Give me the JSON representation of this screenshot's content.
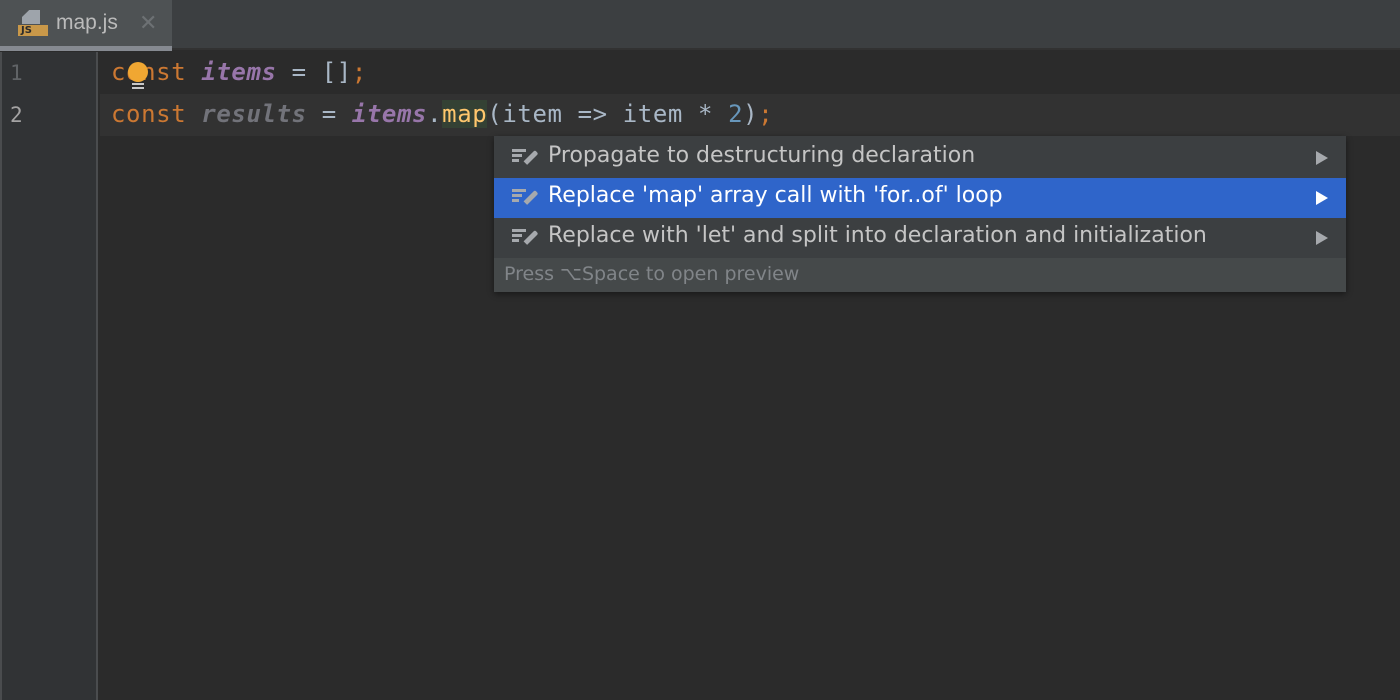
{
  "tabs": [
    {
      "label": "map.js",
      "file_type": "JS",
      "icon": "javascript-file-icon",
      "active": true
    }
  ],
  "editor": {
    "line_numbers": [
      "1",
      "2"
    ],
    "current_line": 2,
    "lines": [
      {
        "tokens": [
          {
            "text": "const",
            "type": "keyword"
          },
          {
            "text": " ",
            "type": "plain"
          },
          {
            "text": "items",
            "type": "global-var"
          },
          {
            "text": " = [];",
            "type": "plain"
          }
        ]
      },
      {
        "tokens": [
          {
            "text": "const",
            "type": "keyword"
          },
          {
            "text": " ",
            "type": "plain"
          },
          {
            "text": "results",
            "type": "unused-var"
          },
          {
            "text": " = ",
            "type": "plain"
          },
          {
            "text": "items",
            "type": "global-var"
          },
          {
            "text": ".",
            "type": "plain"
          },
          {
            "text": "map",
            "type": "function-highlighted"
          },
          {
            "text": "(item => item * ",
            "type": "plain"
          },
          {
            "text": "2",
            "type": "number"
          },
          {
            "text": ")",
            "type": "plain"
          },
          {
            "text": ";",
            "type": "semicolon"
          }
        ]
      }
    ],
    "line1": {
      "kw": "const",
      "sp": " ",
      "var": "items",
      "rest": " = []",
      "semi": ";"
    },
    "line2": {
      "kw": "const",
      "sp": " ",
      "var": "results",
      "eq": " = ",
      "obj": "items",
      "dot": ".",
      "fn": "map",
      "args": "(item => item * ",
      "num": "2",
      "close": ")",
      "semi": ";"
    },
    "intention_bulb_icon": "lightbulb-icon"
  },
  "popup": {
    "items": [
      {
        "label": "Propagate to destructuring declaration",
        "icon": "intention-edit-icon",
        "has_submenu": true,
        "selected": false
      },
      {
        "label": "Replace 'map' array call with 'for..of' loop",
        "icon": "intention-edit-icon",
        "has_submenu": true,
        "selected": true
      },
      {
        "label": "Replace with 'let' and split into declaration and initialization",
        "icon": "intention-edit-icon",
        "has_submenu": true,
        "selected": false
      }
    ],
    "footer_hint": "Press ⌥Space to open preview"
  },
  "colors": {
    "editor_bg": "#2b2b2b",
    "keyword": "#cc7832",
    "global_var": "#9876aa",
    "unused_var": "#72737a",
    "plain": "#a9b7c6",
    "number": "#6897bb",
    "function_highlight": "#ffc66d",
    "selection": "#2f65ca",
    "bulb": "#f0a732"
  }
}
